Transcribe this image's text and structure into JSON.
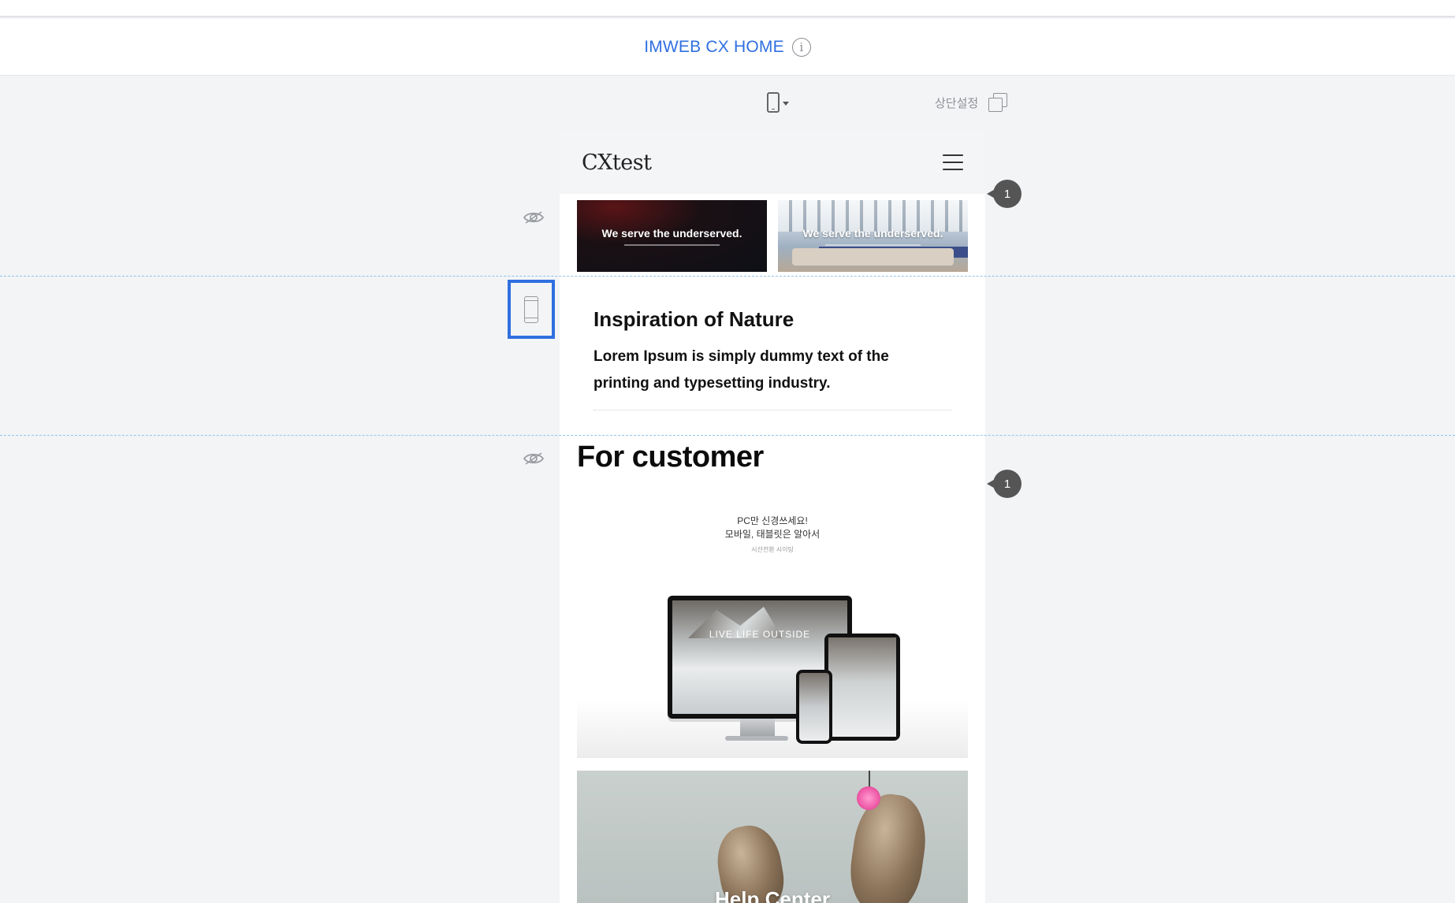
{
  "app": {
    "title": "IMWEB CX HOME",
    "info_icon": "info-icon",
    "info_glyph": "i"
  },
  "toolbar": {
    "device_icon": "mobile-device-icon",
    "header_setting_label": "상단설정",
    "copy_icon": "copy-icon"
  },
  "site": {
    "logo": "CXtest",
    "menu_icon": "hamburger-menu-icon",
    "banners": [
      {
        "text": "We serve the underserved."
      },
      {
        "text": "We serve the underserved."
      }
    ],
    "text_section": {
      "heading": "Inspiration of Nature",
      "body": "Lorem Ipsum is simply dummy text of the printing and typesetting industry."
    },
    "customer_title": "For customer",
    "promo": {
      "line1": "PC만 신경쓰세요!",
      "line2": "모바일, 태블릿은 알아서",
      "line3": "시선전환 시이팅",
      "monitor_text": "LIVE LIFE OUTSIDE"
    },
    "help_center": "Help Center"
  },
  "badges": [
    {
      "count": "1"
    },
    {
      "count": "1"
    }
  ],
  "colors": {
    "accent": "#2f6fe0",
    "guide_line": "#8fc4ec",
    "badge": "#555555"
  }
}
